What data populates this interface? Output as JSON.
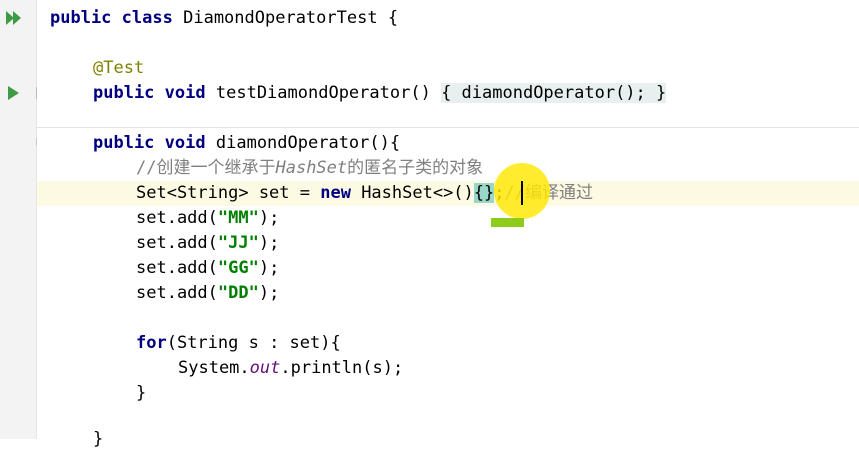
{
  "editor": {
    "lines": {
      "l1": {
        "kw1": "public",
        "kw2": "class",
        "name": "DiamondOperatorTest",
        "brace": "{"
      },
      "l3": {
        "ann": "@Test"
      },
      "l4": {
        "kw1": "public",
        "kw2": "void",
        "sig": "testDiamondOperator()",
        "lbrace": "{",
        "body": " diamondOperator(); ",
        "rbrace": "}"
      },
      "l6": {
        "kw1": "public",
        "kw2": "void",
        "sig": "diamondOperator(){"
      },
      "l7": {
        "pre": "//创建一个继承于",
        "italic": "HashSet",
        "post": "的匿名子类的对象"
      },
      "l8": {
        "decl": "Set<String> set = ",
        "kw": "new",
        "ctor": " HashSet<>()",
        "braces": "{}",
        "semi": ";",
        "cmt": "//编译通过"
      },
      "adds": [
        {
          "pre": "set.add(",
          "arg": "\"MM\"",
          "post": ");"
        },
        {
          "pre": "set.add(",
          "arg": "\"JJ\"",
          "post": ");"
        },
        {
          "pre": "set.add(",
          "arg": "\"GG\"",
          "post": ");"
        },
        {
          "pre": "set.add(",
          "arg": "\"DD\"",
          "post": ");"
        }
      ],
      "l14": {
        "kw": "for",
        "rest": "(String s : set){"
      },
      "l15": {
        "pre": "System.",
        "field": "out",
        "post": ".println(s);"
      },
      "l16": {
        "text": "}"
      },
      "l17": {
        "text": "}"
      }
    }
  },
  "gutter": {
    "icons": [
      "run-all-icon",
      "run-test-icon",
      "fold-expand-icon",
      "fold-collapse-icon"
    ]
  },
  "colors": {
    "keyword": "#000080",
    "string": "#008000",
    "annotation": "#808000",
    "comment": "#808080",
    "static_field": "#660e7a",
    "caret_row": "#fcfae3",
    "run_icon": "#3d9b46",
    "cursor_highlight": "#ffe800"
  }
}
